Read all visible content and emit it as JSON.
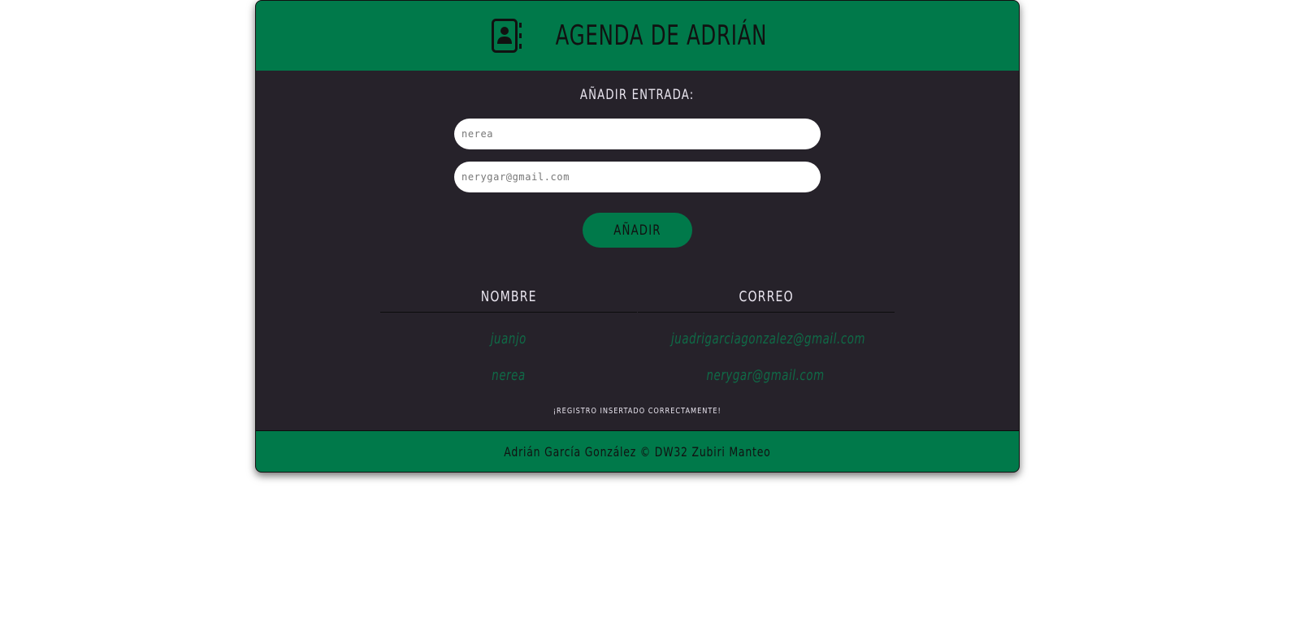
{
  "header": {
    "icon": "address-book-icon",
    "title": "AGENDA DE ADRIÁN"
  },
  "form": {
    "section_label": "AÑADIR ENTRADA:",
    "name_value": "nerea",
    "email_value": "nerygar@gmail.com",
    "submit_label": "AÑADIR"
  },
  "table": {
    "columns": [
      "NOMBRE",
      "CORREO"
    ],
    "rows": [
      [
        "juanjo",
        "juadrigarciagonzalez@gmail.com"
      ],
      [
        "nerea",
        "nerygar@gmail.com"
      ]
    ]
  },
  "status_message": "¡REGISTRO INSERTADO CORRECTAMENTE!",
  "footer": {
    "text": "Adrián García González © DW32 Zubiri Manteo"
  },
  "colors": {
    "accent_green": "#00794a",
    "panel_dark": "#26222a",
    "row_text_green": "#0f6b47"
  }
}
